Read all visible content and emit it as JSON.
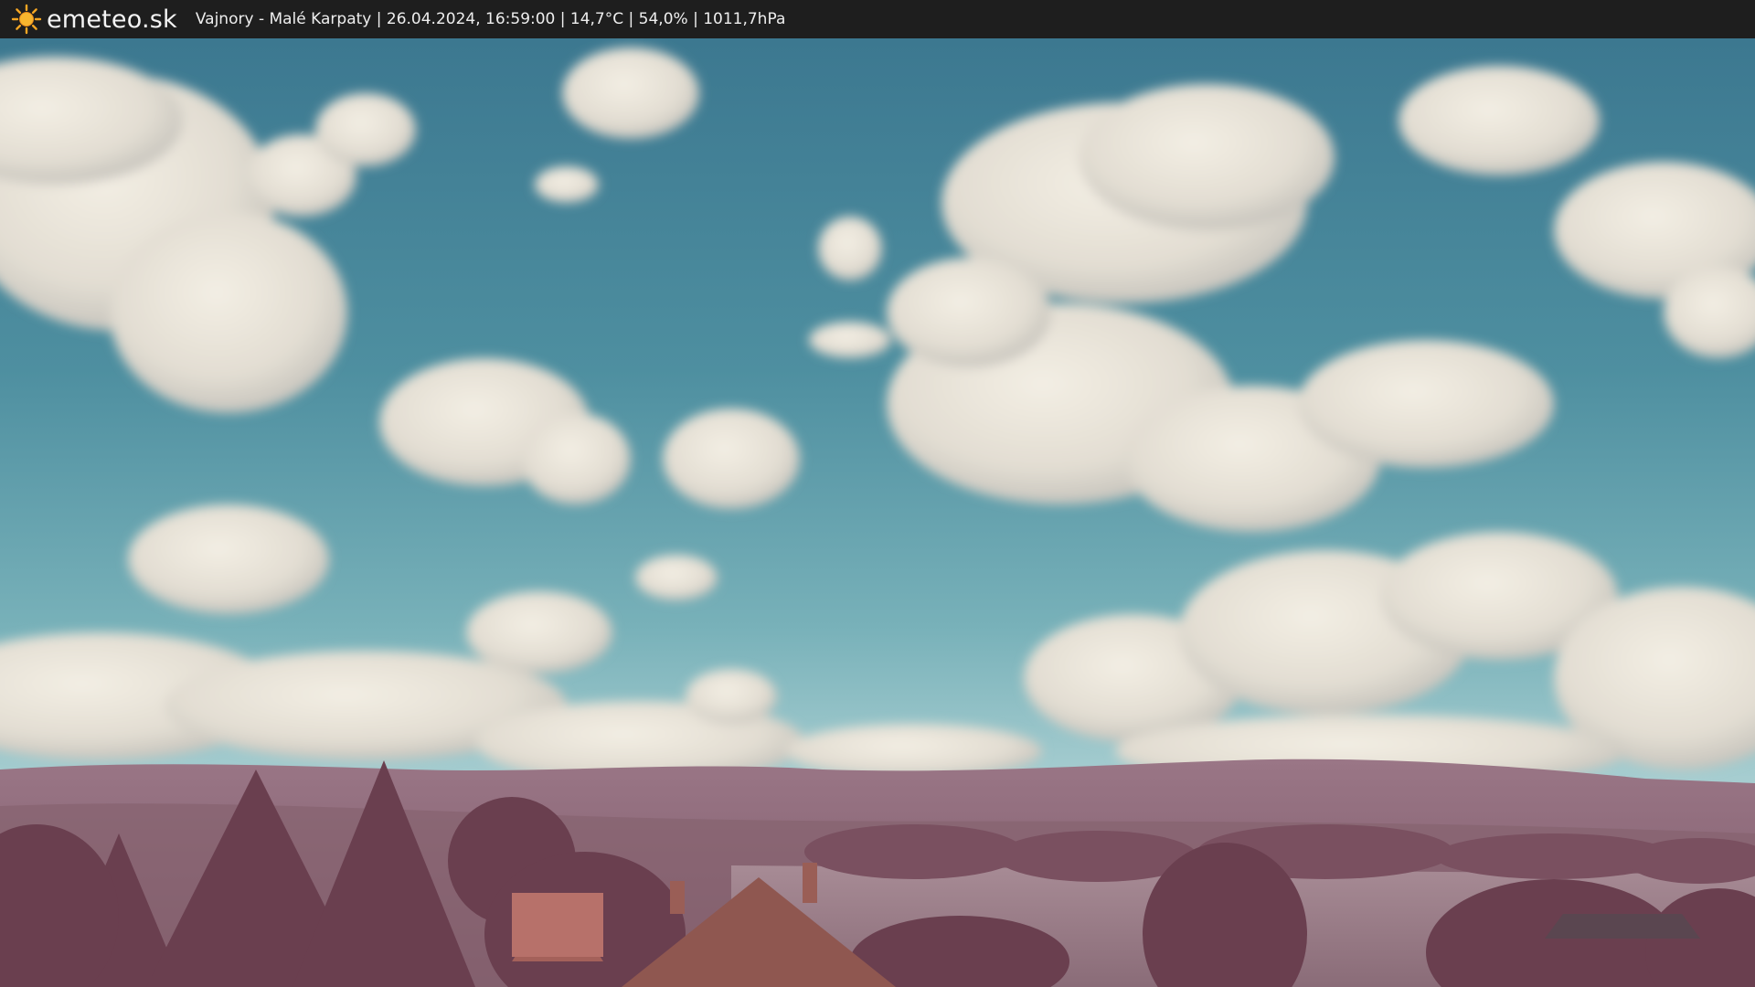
{
  "header": {
    "brand": "emeteo.sk",
    "info": "Vajnory - Malé Karpaty | 26.04.2024, 16:59:00 | 14,7°C | 54,0% | 1011,7hPa",
    "logo_icon": "sun-icon"
  },
  "colors": {
    "bar_background": "#1e1e1e",
    "sun": "#f5a623",
    "sky_top": "#3f7e93",
    "sky_bottom": "#8fc2c8",
    "hills": "#8f6a7a",
    "foliage": "#6e4352"
  }
}
